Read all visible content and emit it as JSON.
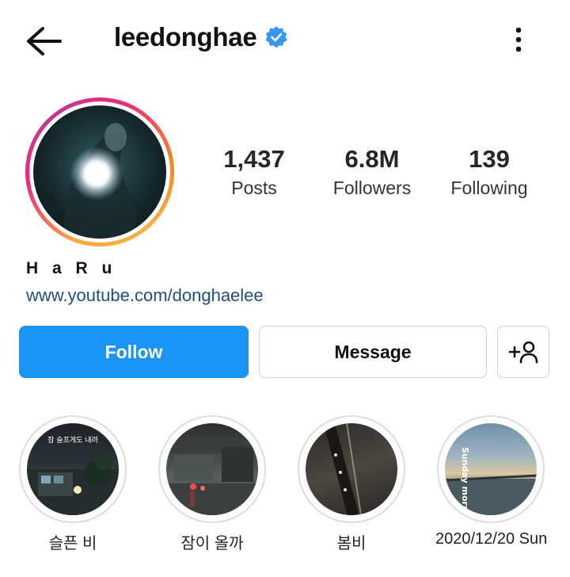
{
  "header": {
    "username": "leedonghae",
    "back_icon": "arrow-left-icon",
    "verified_icon": "verified-badge-icon",
    "more_icon": "more-vertical-icon"
  },
  "profile": {
    "stats": [
      {
        "value": "1,437",
        "label": "Posts"
      },
      {
        "value": "6.8M",
        "label": "Followers"
      },
      {
        "value": "139",
        "label": "Following"
      }
    ],
    "name": "H a R u",
    "link": "www.youtube.com/donghaelee"
  },
  "actions": {
    "follow_label": "Follow",
    "message_label": "Message",
    "add_user_icon": "add-person-icon"
  },
  "highlights": [
    {
      "label": "슬픈 비",
      "overlay_text": "참 슬프게도 내려"
    },
    {
      "label": "잠이 올까"
    },
    {
      "label": "봄비"
    },
    {
      "label": "2020/12/20 Sun",
      "overlay_text": "Sunday morni"
    }
  ],
  "colors": {
    "follow_button": "#1b95f5",
    "verified": "#3897f0",
    "link": "#1f4f7f"
  }
}
